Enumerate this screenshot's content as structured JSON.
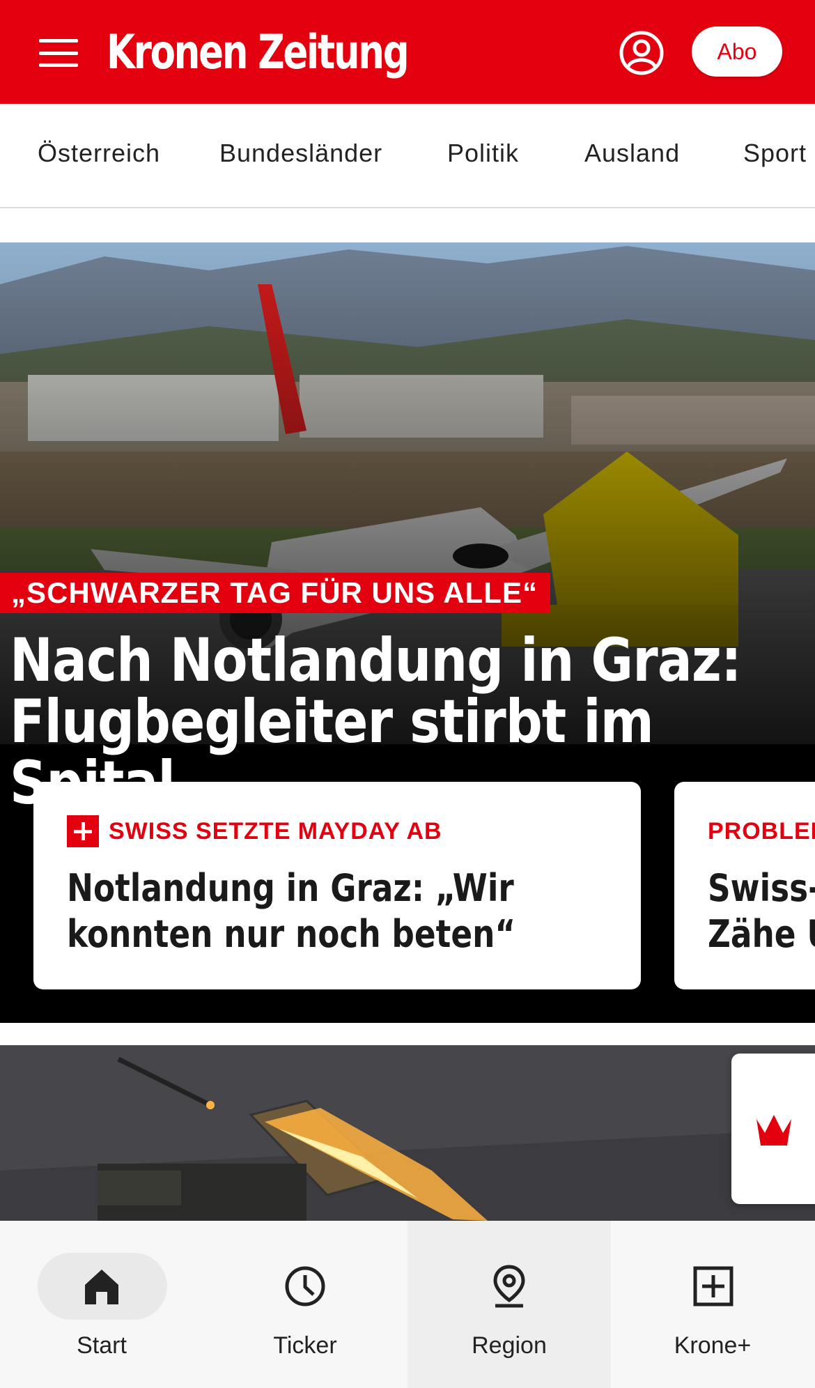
{
  "header": {
    "logo_text": "Kronen Zeitung",
    "abo_label": "Abo",
    "brand_color": "#e3000f"
  },
  "nav": {
    "categories": [
      "Österreich",
      "Bundesländer",
      "Politik",
      "Ausland",
      "Sport"
    ]
  },
  "hero": {
    "kicker": "„SCHWARZER TAG FÜR UNS ALLE“",
    "headline_line1": "Nach Notlandung in Graz:",
    "headline_line2": "Flugbegleiter stirbt im Spital",
    "image_icon": "airplane-photo"
  },
  "cards": [
    {
      "kicker": "SWISS SETZTE MAYDAY AB",
      "title_line1": "Notlandung in Graz: „Wir",
      "title_line2": "konnten nur noch beten“",
      "plus": true
    },
    {
      "kicker": "PROBLEM",
      "title_line1": "Swiss-",
      "title_line2": "Zähe U",
      "plus": false
    }
  ],
  "second_article": {
    "image_icon": "rocket-launcher-photo"
  },
  "bottom_nav": {
    "tabs": [
      {
        "label": "Start",
        "icon": "home-icon",
        "active": true
      },
      {
        "label": "Ticker",
        "icon": "clock-icon",
        "active": false
      },
      {
        "label": "Region",
        "icon": "location-pin-icon",
        "active": false
      },
      {
        "label": "Krone+",
        "icon": "plus-square-icon",
        "active": false
      }
    ]
  }
}
